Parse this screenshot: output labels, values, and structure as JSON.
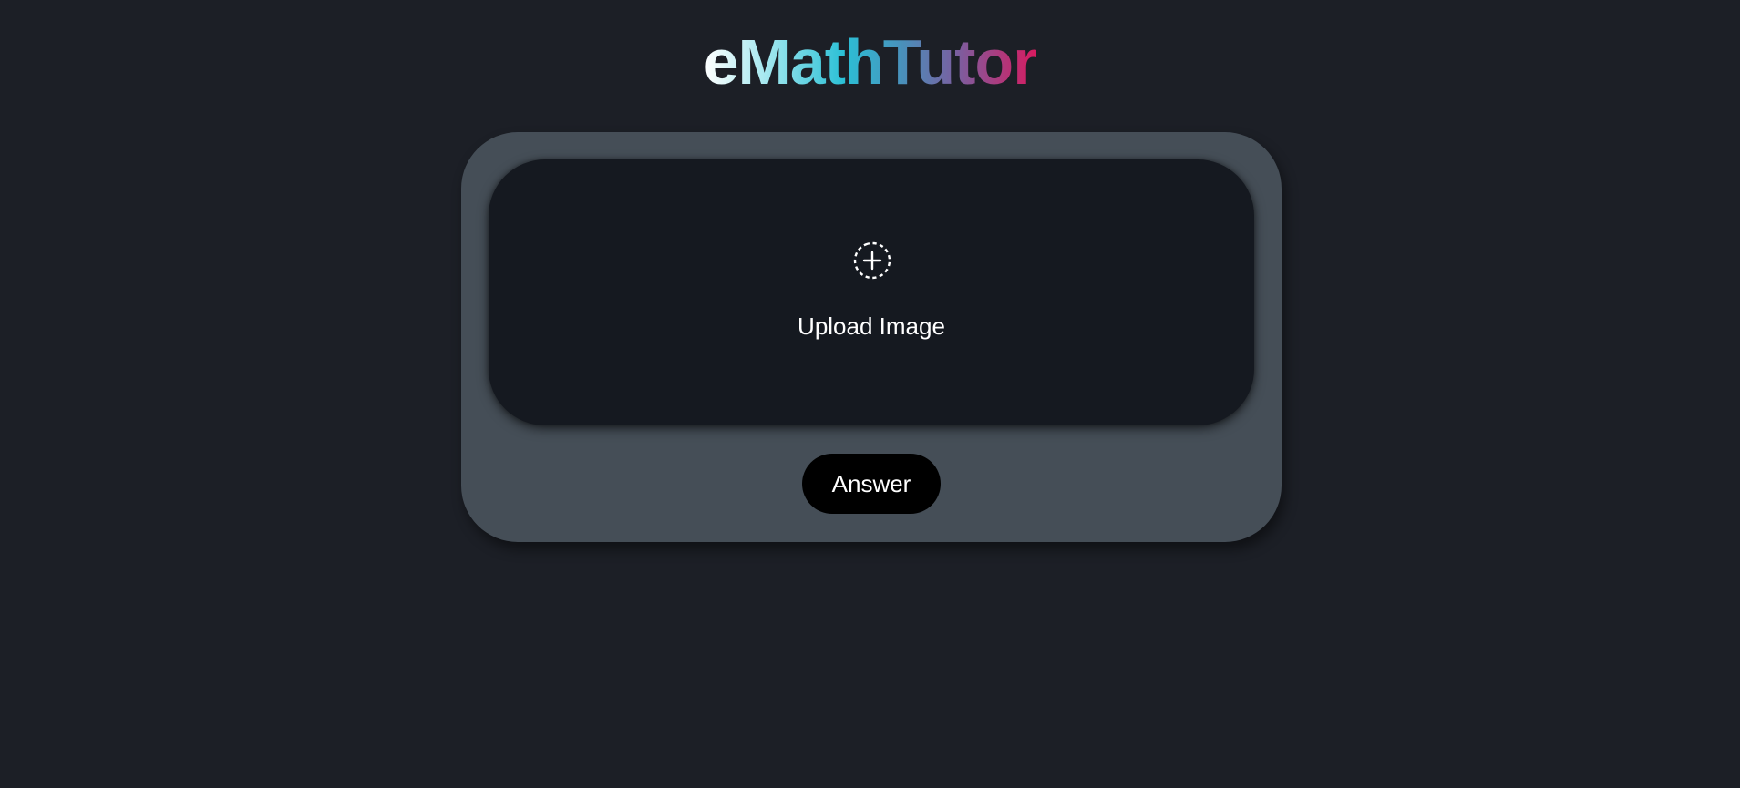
{
  "app": {
    "title": "eMathTutor",
    "title_gradient": [
      "#ffffff",
      "#a8e9f0",
      "#2bc0d6",
      "#4a8fba",
      "#7a5fa0",
      "#d81b60"
    ]
  },
  "upload": {
    "icon": "add-circle-dashed-icon",
    "label": "Upload Image"
  },
  "actions": {
    "answer_label": "Answer"
  },
  "colors": {
    "background": "#1c1f26",
    "card": "#454e57",
    "upload_area": "#151920",
    "button": "#000000",
    "text": "#ffffff"
  }
}
